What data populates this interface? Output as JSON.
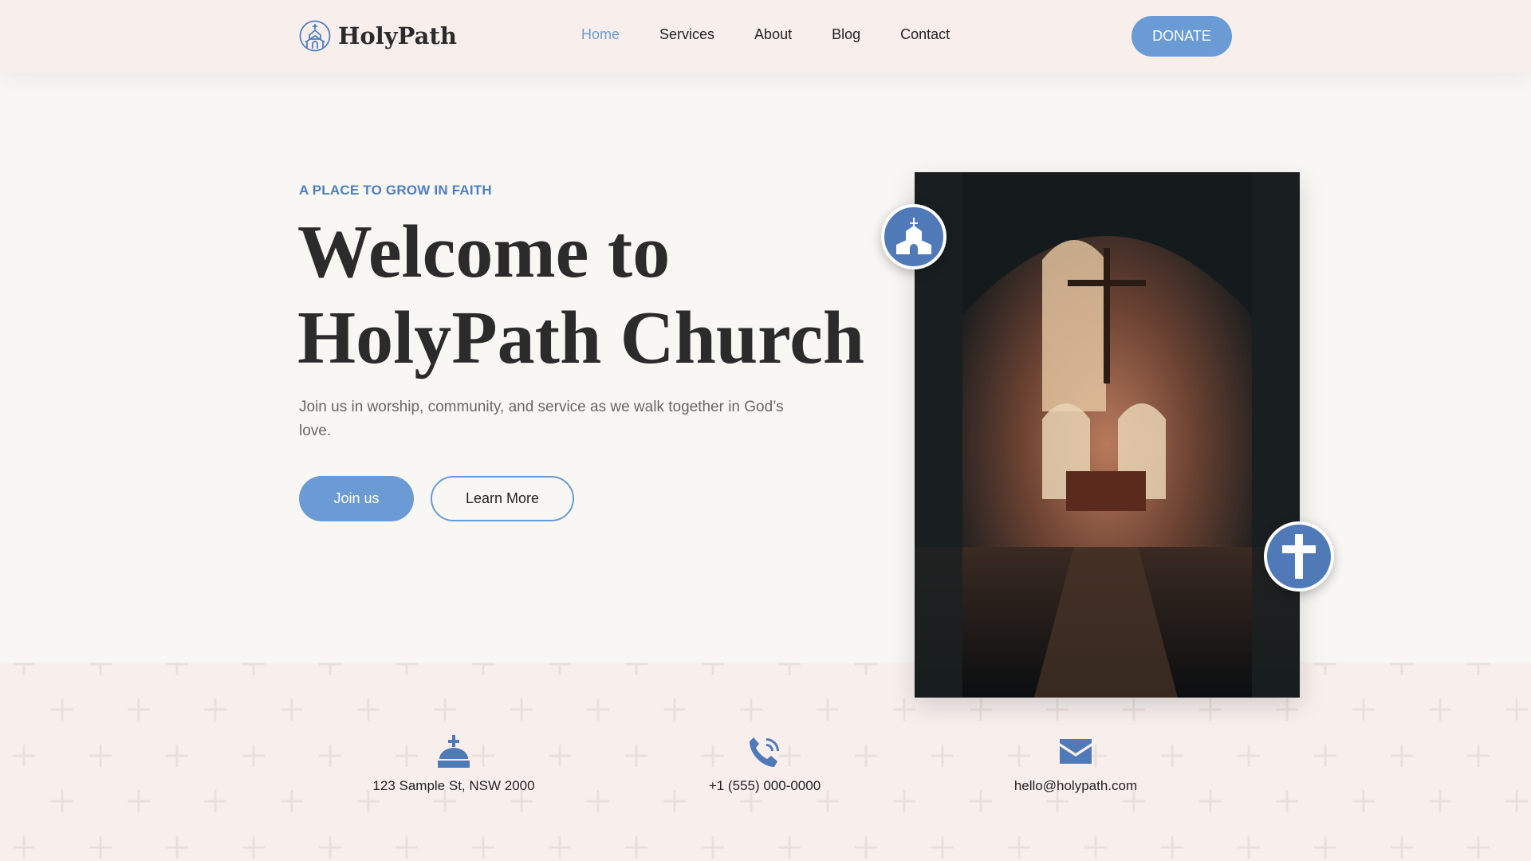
{
  "nav": {
    "brand": "HolyPath",
    "links": [
      {
        "label": "Home",
        "active": true
      },
      {
        "label": "Services"
      },
      {
        "label": "About"
      },
      {
        "label": "Blog"
      },
      {
        "label": "Contact"
      }
    ],
    "donate": "DONATE"
  },
  "hero": {
    "tagline": "A PLACE TO GROW IN FAITH",
    "title_line1": "Welcome to",
    "title_line2": "HolyPath Church",
    "description": "Join us in worship, community, and service as we walk together in God’s love.",
    "primary_button": "Join us",
    "secondary_button": "Learn More"
  },
  "contact": {
    "address": "123 Sample St, NSW 2000",
    "phone": "+1 (555) 000-0000",
    "email": "hello@holypath.com"
  },
  "colors": {
    "accent": "#6a9bd4",
    "accent_dark": "#5079b8",
    "nav_bg": "#f8efed",
    "page_bg": "#f9f7f4"
  }
}
